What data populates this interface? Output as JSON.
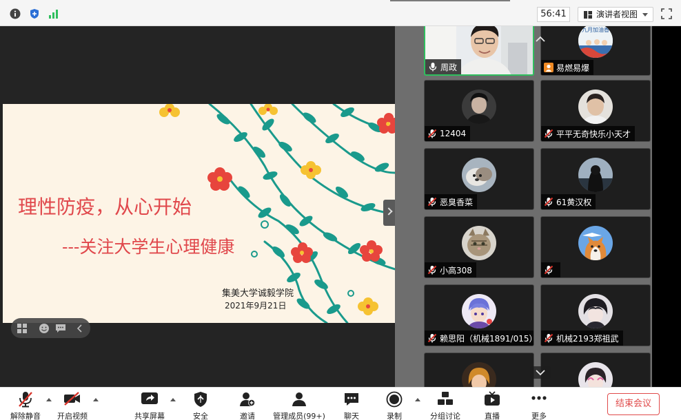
{
  "topbar": {
    "timer": "56:41",
    "view_label": "演讲者视图"
  },
  "slide": {
    "title": "理性防疫，从心开始",
    "subtitle": "---关注大学生心理健康",
    "school": "集美大学诚毅学院",
    "date": "2021年9月21日"
  },
  "gallery": {
    "participants": [
      {
        "name": "周政",
        "active": true
      },
      {
        "name": "易燃易爆"
      },
      {
        "name": "12404"
      },
      {
        "name": "平平无奇快乐小天才"
      },
      {
        "name": "恶臭香菜"
      },
      {
        "name": "61黄汉权"
      },
      {
        "name": "小高308"
      },
      {
        "name": ""
      },
      {
        "name": "赖思阳（机械1891/015）"
      },
      {
        "name": "机械2193郑祖武"
      }
    ],
    "avatar_badge_text": "九月加油香"
  },
  "toolbar": {
    "unmute": "解除静音",
    "start_video": "开启视频",
    "share_screen": "共享屏幕",
    "security": "安全",
    "invite": "邀请",
    "manage_participants": "管理成员(99+)",
    "chat": "聊天",
    "record": "录制",
    "breakout": "分组讨论",
    "live": "直播",
    "more": "更多",
    "end_meeting": "结束会议"
  },
  "colors": {
    "active_border": "#2fbf5e",
    "slide_title": "#e0474b",
    "end_button": "#e04a4a",
    "mic_off": "#d9342b"
  }
}
